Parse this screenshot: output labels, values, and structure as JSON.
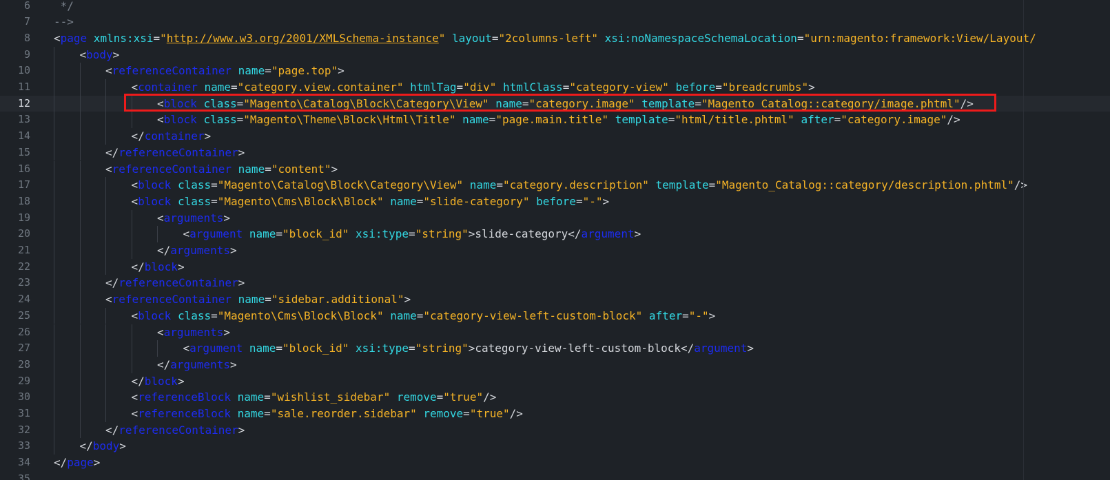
{
  "editor": {
    "theme_colors": {
      "background": "#1e2227",
      "tag": "#1d2cf0",
      "attribute": "#33d8e3",
      "string": "#f5b326",
      "text": "#d4d7dc",
      "comment": "#7a828c",
      "line_number": "#6f7780",
      "highlight_box": "#ee1b1b"
    },
    "active_line": "12",
    "lines": [
      {
        "num": "6",
        "indent": 0,
        "tokens": [
          {
            "t": "com",
            "v": " */"
          }
        ]
      },
      {
        "num": "7",
        "indent": 0,
        "tokens": [
          {
            "t": "com",
            "v": "-->"
          }
        ]
      },
      {
        "num": "8",
        "indent": 0,
        "tokens": [
          {
            "t": "punc",
            "v": "<"
          },
          {
            "t": "tag",
            "v": "page"
          },
          {
            "t": "attr",
            "v": " xmlns:xsi"
          },
          {
            "t": "punc",
            "v": "="
          },
          {
            "t": "str",
            "v": "\""
          },
          {
            "t": "url",
            "v": "http://www.w3.org/2001/XMLSchema-instance"
          },
          {
            "t": "str",
            "v": "\""
          },
          {
            "t": "attr",
            "v": " layout"
          },
          {
            "t": "punc",
            "v": "="
          },
          {
            "t": "str",
            "v": "\"2columns-left\""
          },
          {
            "t": "attr",
            "v": " xsi:noNamespaceSchemaLocation"
          },
          {
            "t": "punc",
            "v": "="
          },
          {
            "t": "str",
            "v": "\"urn:magento:framework:View/Layout/"
          }
        ]
      },
      {
        "num": "9",
        "indent": 1,
        "tokens": [
          {
            "t": "punc",
            "v": "<"
          },
          {
            "t": "tag",
            "v": "body"
          },
          {
            "t": "punc",
            "v": ">"
          }
        ]
      },
      {
        "num": "10",
        "indent": 2,
        "tokens": [
          {
            "t": "punc",
            "v": "<"
          },
          {
            "t": "tag",
            "v": "referenceContainer"
          },
          {
            "t": "attr",
            "v": " name"
          },
          {
            "t": "punc",
            "v": "="
          },
          {
            "t": "str",
            "v": "\"page.top\""
          },
          {
            "t": "punc",
            "v": ">"
          }
        ]
      },
      {
        "num": "11",
        "indent": 3,
        "tokens": [
          {
            "t": "punc",
            "v": "<"
          },
          {
            "t": "tag",
            "v": "container"
          },
          {
            "t": "attr",
            "v": " name"
          },
          {
            "t": "punc",
            "v": "="
          },
          {
            "t": "str",
            "v": "\"category.view.container\""
          },
          {
            "t": "attr",
            "v": " htmlTag"
          },
          {
            "t": "punc",
            "v": "="
          },
          {
            "t": "str",
            "v": "\"div\""
          },
          {
            "t": "attr",
            "v": " htmlClass"
          },
          {
            "t": "punc",
            "v": "="
          },
          {
            "t": "str",
            "v": "\"category-view\""
          },
          {
            "t": "attr",
            "v": " before"
          },
          {
            "t": "punc",
            "v": "="
          },
          {
            "t": "str",
            "v": "\"breadcrumbs\""
          },
          {
            "t": "punc",
            "v": ">"
          }
        ]
      },
      {
        "num": "12",
        "indent": 4,
        "tokens": [
          {
            "t": "punc",
            "v": "<"
          },
          {
            "t": "tag",
            "v": "block"
          },
          {
            "t": "attr",
            "v": " class"
          },
          {
            "t": "punc",
            "v": "="
          },
          {
            "t": "str",
            "v": "\"Magento\\Catalog\\Block\\Category\\View\""
          },
          {
            "t": "attr",
            "v": " name"
          },
          {
            "t": "punc",
            "v": "="
          },
          {
            "t": "str",
            "v": "\"category.image\""
          },
          {
            "t": "attr",
            "v": " template"
          },
          {
            "t": "punc",
            "v": "="
          },
          {
            "t": "str",
            "v": "\"Magento_Catalog::category/image.phtml\""
          },
          {
            "t": "punc",
            "v": "/>"
          }
        ]
      },
      {
        "num": "13",
        "indent": 4,
        "tokens": [
          {
            "t": "punc",
            "v": "<"
          },
          {
            "t": "tag",
            "v": "block"
          },
          {
            "t": "attr",
            "v": " class"
          },
          {
            "t": "punc",
            "v": "="
          },
          {
            "t": "str",
            "v": "\"Magento\\Theme\\Block\\Html\\Title\""
          },
          {
            "t": "attr",
            "v": " name"
          },
          {
            "t": "punc",
            "v": "="
          },
          {
            "t": "str",
            "v": "\"page.main.title\""
          },
          {
            "t": "attr",
            "v": " template"
          },
          {
            "t": "punc",
            "v": "="
          },
          {
            "t": "str",
            "v": "\"html/title.phtml\""
          },
          {
            "t": "attr",
            "v": " after"
          },
          {
            "t": "punc",
            "v": "="
          },
          {
            "t": "str",
            "v": "\"category.image\""
          },
          {
            "t": "punc",
            "v": "/>"
          }
        ]
      },
      {
        "num": "14",
        "indent": 3,
        "tokens": [
          {
            "t": "punc",
            "v": "</"
          },
          {
            "t": "tag",
            "v": "container"
          },
          {
            "t": "punc",
            "v": ">"
          }
        ]
      },
      {
        "num": "15",
        "indent": 2,
        "tokens": [
          {
            "t": "punc",
            "v": "</"
          },
          {
            "t": "tag",
            "v": "referenceContainer"
          },
          {
            "t": "punc",
            "v": ">"
          }
        ]
      },
      {
        "num": "16",
        "indent": 2,
        "tokens": [
          {
            "t": "punc",
            "v": "<"
          },
          {
            "t": "tag",
            "v": "referenceContainer"
          },
          {
            "t": "attr",
            "v": " name"
          },
          {
            "t": "punc",
            "v": "="
          },
          {
            "t": "str",
            "v": "\"content\""
          },
          {
            "t": "punc",
            "v": ">"
          }
        ]
      },
      {
        "num": "17",
        "indent": 3,
        "tokens": [
          {
            "t": "punc",
            "v": "<"
          },
          {
            "t": "tag",
            "v": "block"
          },
          {
            "t": "attr",
            "v": " class"
          },
          {
            "t": "punc",
            "v": "="
          },
          {
            "t": "str",
            "v": "\"Magento\\Catalog\\Block\\Category\\View\""
          },
          {
            "t": "attr",
            "v": " name"
          },
          {
            "t": "punc",
            "v": "="
          },
          {
            "t": "str",
            "v": "\"category.description\""
          },
          {
            "t": "attr",
            "v": " template"
          },
          {
            "t": "punc",
            "v": "="
          },
          {
            "t": "str",
            "v": "\"Magento_Catalog::category/description.phtml\""
          },
          {
            "t": "punc",
            "v": "/>"
          }
        ]
      },
      {
        "num": "18",
        "indent": 3,
        "tokens": [
          {
            "t": "punc",
            "v": "<"
          },
          {
            "t": "tag",
            "v": "block"
          },
          {
            "t": "attr",
            "v": " class"
          },
          {
            "t": "punc",
            "v": "="
          },
          {
            "t": "str",
            "v": "\"Magento\\Cms\\Block\\Block\""
          },
          {
            "t": "attr",
            "v": " name"
          },
          {
            "t": "punc",
            "v": "="
          },
          {
            "t": "str",
            "v": "\"slide-category\""
          },
          {
            "t": "attr",
            "v": " before"
          },
          {
            "t": "punc",
            "v": "="
          },
          {
            "t": "str",
            "v": "\"-\""
          },
          {
            "t": "punc",
            "v": ">"
          }
        ]
      },
      {
        "num": "19",
        "indent": 4,
        "tokens": [
          {
            "t": "punc",
            "v": "<"
          },
          {
            "t": "tag",
            "v": "arguments"
          },
          {
            "t": "punc",
            "v": ">"
          }
        ]
      },
      {
        "num": "20",
        "indent": 5,
        "tokens": [
          {
            "t": "punc",
            "v": "<"
          },
          {
            "t": "tag",
            "v": "argument"
          },
          {
            "t": "attr",
            "v": " name"
          },
          {
            "t": "punc",
            "v": "="
          },
          {
            "t": "str",
            "v": "\"block_id\""
          },
          {
            "t": "attr",
            "v": " xsi:type"
          },
          {
            "t": "punc",
            "v": "="
          },
          {
            "t": "str",
            "v": "\"string\""
          },
          {
            "t": "punc",
            "v": ">"
          },
          {
            "t": "text",
            "v": "slide-category"
          },
          {
            "t": "punc",
            "v": "</"
          },
          {
            "t": "tag",
            "v": "argument"
          },
          {
            "t": "punc",
            "v": ">"
          }
        ]
      },
      {
        "num": "21",
        "indent": 4,
        "tokens": [
          {
            "t": "punc",
            "v": "</"
          },
          {
            "t": "tag",
            "v": "arguments"
          },
          {
            "t": "punc",
            "v": ">"
          }
        ]
      },
      {
        "num": "22",
        "indent": 3,
        "tokens": [
          {
            "t": "punc",
            "v": "</"
          },
          {
            "t": "tag",
            "v": "block"
          },
          {
            "t": "punc",
            "v": ">"
          }
        ]
      },
      {
        "num": "23",
        "indent": 2,
        "tokens": [
          {
            "t": "punc",
            "v": "</"
          },
          {
            "t": "tag",
            "v": "referenceContainer"
          },
          {
            "t": "punc",
            "v": ">"
          }
        ]
      },
      {
        "num": "24",
        "indent": 2,
        "tokens": [
          {
            "t": "punc",
            "v": "<"
          },
          {
            "t": "tag",
            "v": "referenceContainer"
          },
          {
            "t": "attr",
            "v": " name"
          },
          {
            "t": "punc",
            "v": "="
          },
          {
            "t": "str",
            "v": "\"sidebar.additional\""
          },
          {
            "t": "punc",
            "v": ">"
          }
        ]
      },
      {
        "num": "25",
        "indent": 3,
        "tokens": [
          {
            "t": "punc",
            "v": "<"
          },
          {
            "t": "tag",
            "v": "block"
          },
          {
            "t": "attr",
            "v": " class"
          },
          {
            "t": "punc",
            "v": "="
          },
          {
            "t": "str",
            "v": "\"Magento\\Cms\\Block\\Block\""
          },
          {
            "t": "attr",
            "v": " name"
          },
          {
            "t": "punc",
            "v": "="
          },
          {
            "t": "str",
            "v": "\"category-view-left-custom-block\""
          },
          {
            "t": "attr",
            "v": " after"
          },
          {
            "t": "punc",
            "v": "="
          },
          {
            "t": "str",
            "v": "\"-\""
          },
          {
            "t": "punc",
            "v": ">"
          }
        ]
      },
      {
        "num": "26",
        "indent": 4,
        "tokens": [
          {
            "t": "punc",
            "v": "<"
          },
          {
            "t": "tag",
            "v": "arguments"
          },
          {
            "t": "punc",
            "v": ">"
          }
        ]
      },
      {
        "num": "27",
        "indent": 5,
        "tokens": [
          {
            "t": "punc",
            "v": "<"
          },
          {
            "t": "tag",
            "v": "argument"
          },
          {
            "t": "attr",
            "v": " name"
          },
          {
            "t": "punc",
            "v": "="
          },
          {
            "t": "str",
            "v": "\"block_id\""
          },
          {
            "t": "attr",
            "v": " xsi:type"
          },
          {
            "t": "punc",
            "v": "="
          },
          {
            "t": "str",
            "v": "\"string\""
          },
          {
            "t": "punc",
            "v": ">"
          },
          {
            "t": "text",
            "v": "category-view-left-custom-block"
          },
          {
            "t": "punc",
            "v": "</"
          },
          {
            "t": "tag",
            "v": "argument"
          },
          {
            "t": "punc",
            "v": ">"
          }
        ]
      },
      {
        "num": "28",
        "indent": 4,
        "tokens": [
          {
            "t": "punc",
            "v": "</"
          },
          {
            "t": "tag",
            "v": "arguments"
          },
          {
            "t": "punc",
            "v": ">"
          }
        ]
      },
      {
        "num": "29",
        "indent": 3,
        "tokens": [
          {
            "t": "punc",
            "v": "</"
          },
          {
            "t": "tag",
            "v": "block"
          },
          {
            "t": "punc",
            "v": ">"
          }
        ]
      },
      {
        "num": "30",
        "indent": 3,
        "tokens": [
          {
            "t": "punc",
            "v": "<"
          },
          {
            "t": "tag",
            "v": "referenceBlock"
          },
          {
            "t": "attr",
            "v": " name"
          },
          {
            "t": "punc",
            "v": "="
          },
          {
            "t": "str",
            "v": "\"wishlist_sidebar\""
          },
          {
            "t": "attr",
            "v": " remove"
          },
          {
            "t": "punc",
            "v": "="
          },
          {
            "t": "str",
            "v": "\"true\""
          },
          {
            "t": "punc",
            "v": "/>"
          }
        ]
      },
      {
        "num": "31",
        "indent": 3,
        "tokens": [
          {
            "t": "punc",
            "v": "<"
          },
          {
            "t": "tag",
            "v": "referenceBlock"
          },
          {
            "t": "attr",
            "v": " name"
          },
          {
            "t": "punc",
            "v": "="
          },
          {
            "t": "str",
            "v": "\"sale.reorder.sidebar\""
          },
          {
            "t": "attr",
            "v": " remove"
          },
          {
            "t": "punc",
            "v": "="
          },
          {
            "t": "str",
            "v": "\"true\""
          },
          {
            "t": "punc",
            "v": "/>"
          }
        ]
      },
      {
        "num": "32",
        "indent": 2,
        "tokens": [
          {
            "t": "punc",
            "v": "</"
          },
          {
            "t": "tag",
            "v": "referenceContainer"
          },
          {
            "t": "punc",
            "v": ">"
          }
        ]
      },
      {
        "num": "33",
        "indent": 1,
        "tokens": [
          {
            "t": "punc",
            "v": "</"
          },
          {
            "t": "tag",
            "v": "body"
          },
          {
            "t": "punc",
            "v": ">"
          }
        ]
      },
      {
        "num": "34",
        "indent": 0,
        "tokens": [
          {
            "t": "punc",
            "v": "</"
          },
          {
            "t": "tag",
            "v": "page"
          },
          {
            "t": "punc",
            "v": ">"
          }
        ]
      },
      {
        "num": "35",
        "indent": 0,
        "tokens": []
      }
    ]
  }
}
